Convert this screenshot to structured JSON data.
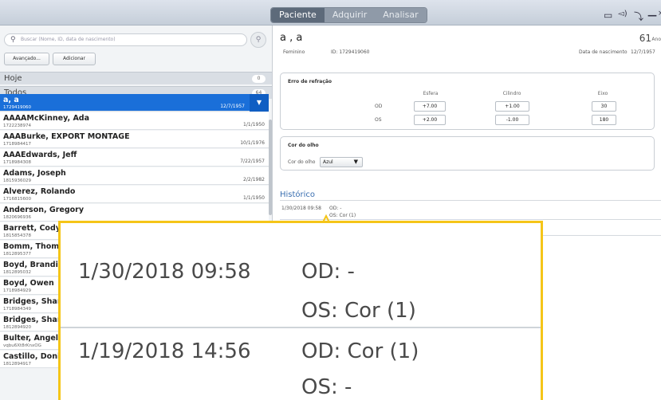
{
  "topbar": {
    "tabs": [
      {
        "label": "Paciente",
        "active": true
      },
      {
        "label": "Adquirir",
        "active": false
      },
      {
        "label": "Analisar",
        "active": false
      }
    ],
    "icons": [
      "display-icon",
      "volume-icon",
      "wrench-icon",
      "minimize-icon",
      "close-icon"
    ]
  },
  "sidebar": {
    "search_placeholder": "Buscar (Nome, ID, data de nascimento)",
    "advanced_label": "Avançado...",
    "add_label": "Adicionar",
    "groups": [
      {
        "label": "Hoje",
        "count": "0"
      },
      {
        "label": "Todos",
        "count": "64"
      }
    ],
    "patients": [
      {
        "name": "a, a",
        "id": "1729419060",
        "dob": "12/7/1957",
        "selected": true
      },
      {
        "name": "AAAAMcKinney, Ada",
        "id": "1722238974",
        "dob": "1/1/1950"
      },
      {
        "name": "AAABurke, EXPORT MONTAGE",
        "id": "1718984417",
        "dob": "10/1/1976"
      },
      {
        "name": "AAAEdwards, Jeff",
        "id": "1718984308",
        "dob": "7/22/1957"
      },
      {
        "name": "Adams, Joseph",
        "id": "1815936029",
        "dob": "2/2/1982"
      },
      {
        "name": "Alverez, Rolando",
        "id": "1716815600",
        "dob": "1/1/1950"
      },
      {
        "name": "Anderson, Gregory",
        "id": "1820696936",
        "dob": ""
      },
      {
        "name": "Barrett, Cody",
        "id": "1815854378",
        "dob": ""
      },
      {
        "name": "Bomm, Thom",
        "id": "1812895377",
        "dob": ""
      },
      {
        "name": "Boyd, Brandi",
        "id": "1812895032",
        "dob": ""
      },
      {
        "name": "Boyd, Owen",
        "id": "1718984929",
        "dob": ""
      },
      {
        "name": "Bridges, Shar",
        "id": "1718984349",
        "dob": ""
      },
      {
        "name": "Bridges, Shar",
        "id": "1812894920",
        "dob": ""
      },
      {
        "name": "Bulter, Angel",
        "id": "vqbu6Xt8rKnxOG",
        "dob": ""
      },
      {
        "name": "Castillo, Doni",
        "id": "1812894917",
        "dob": ""
      }
    ]
  },
  "patient": {
    "name": "a , a",
    "age": "61",
    "age_unit": "Ano",
    "sex": "Feminino",
    "id_label": "ID: 1729419060",
    "dob_label": "Data de nascimento",
    "dob": "12/7/1957"
  },
  "refraction": {
    "title": "Erro de refração",
    "columns": [
      "Esfera",
      "Cilindro",
      "Eixo"
    ],
    "rows": [
      {
        "eye": "OD",
        "values": [
          "+7.00",
          "+1.00",
          "30"
        ]
      },
      {
        "eye": "OS",
        "values": [
          "+2.00",
          "-1.00",
          "180"
        ]
      }
    ]
  },
  "eye_color": {
    "title": "Cor do olho",
    "label": "Cor do olho",
    "value": "Azul"
  },
  "history": {
    "title": "Histórico",
    "entries": [
      {
        "time": "1/30/2018 09:58",
        "od": "OD: -",
        "os": "OS: Cor (1)"
      },
      {
        "time": "1/19/2018 14:56",
        "od": "OD: Cor (1)",
        "os": "OS: -"
      }
    ]
  },
  "colors": {
    "accent": "#1a6fd9",
    "highlight": "#f5c518",
    "history_title": "#3a6fb0"
  }
}
